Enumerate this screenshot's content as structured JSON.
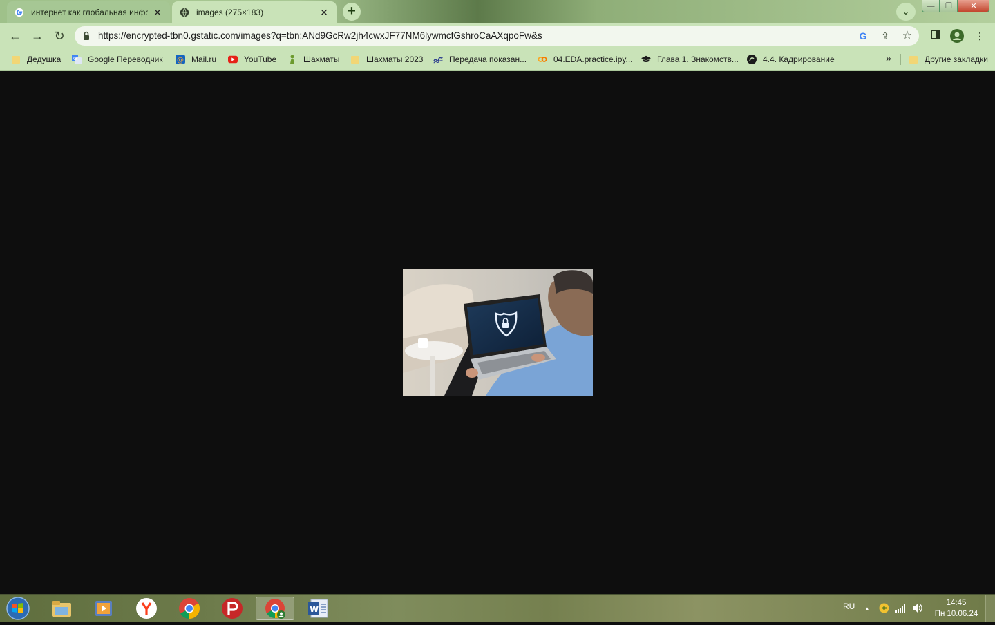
{
  "browser": {
    "tabs": [
      {
        "title": "интернет как глобальная инфор",
        "favicon": "google-g-icon",
        "active": false
      },
      {
        "title": "images (275×183)",
        "favicon": "globe-icon",
        "active": true
      }
    ],
    "close_glyph": "✕",
    "new_tab_glyph": "+",
    "tab_search_glyph": "⌄",
    "window_controls": {
      "minimize": "—",
      "maximize": "❐",
      "close": "✕"
    }
  },
  "toolbar": {
    "back": "←",
    "forward": "→",
    "reload": "↻",
    "url": "https://encrypted-tbn0.gstatic.com/images?q=tbn:ANd9GcRw2jh4cwxJF77NM6lywmcfGshroCaAXqpoFw&s",
    "google_lens": "G",
    "share": "⇪",
    "star": "☆",
    "menu": "⋮"
  },
  "bookmarks": {
    "items": [
      {
        "label": "Дедушка",
        "icon": "folder-icon"
      },
      {
        "label": "Google Переводчик",
        "icon": "google-translate-icon"
      },
      {
        "label": "Mail.ru",
        "icon": "mailru-icon"
      },
      {
        "label": "YouTube",
        "icon": "youtube-icon"
      },
      {
        "label": "Шахматы",
        "icon": "chess-pawn-icon"
      },
      {
        "label": "Шахматы 2023",
        "icon": "folder-icon"
      },
      {
        "label": "Передача показан...",
        "icon": "swirl-icon"
      },
      {
        "label": "04.EDA.practice.ipy...",
        "icon": "colab-icon"
      },
      {
        "label": "Глава 1. Знакомств...",
        "icon": "graduation-cap-icon"
      },
      {
        "label": "4.4. Кадрирование",
        "icon": "stepik-icon"
      }
    ],
    "more": "»",
    "other": "Другие закладки"
  },
  "content": {
    "image_alt": "images (275×183)",
    "image_subject": "man-with-laptop-security-shield-lock"
  },
  "taskbar": {
    "apps": [
      {
        "name": "explorer-icon",
        "active": false
      },
      {
        "name": "media-player-icon",
        "active": false
      },
      {
        "name": "yandex-browser-icon",
        "active": false
      },
      {
        "name": "chrome-icon",
        "active": false
      },
      {
        "name": "psiphon-icon",
        "active": false
      },
      {
        "name": "chrome-profile-icon",
        "active": true
      },
      {
        "name": "word-icon",
        "active": false
      }
    ],
    "tray": {
      "language": "RU",
      "up_arrow": "▲",
      "time": "14:45",
      "date": "Пн 10.06.24"
    }
  }
}
